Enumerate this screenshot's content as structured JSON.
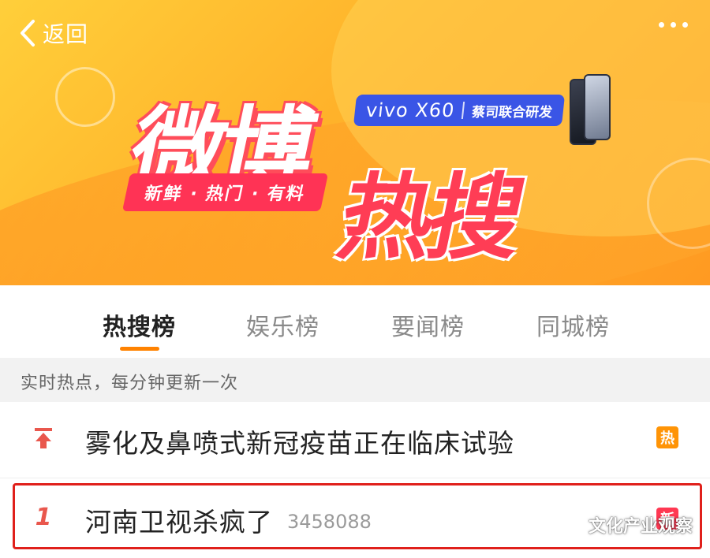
{
  "nav": {
    "back_label": "返回"
  },
  "banner": {
    "logo_text": "微博",
    "logo_hot_text": "热搜",
    "tagline": "新鲜 · 热门 · 有料",
    "sponsor_model": "vivo X60",
    "sponsor_note": "蔡司联合研发"
  },
  "tabs": [
    {
      "label": "热搜榜",
      "active": true
    },
    {
      "label": "娱乐榜",
      "active": false
    },
    {
      "label": "要闻榜",
      "active": false
    },
    {
      "label": "同城榜",
      "active": false
    }
  ],
  "subheader": "实时热点，每分钟更新一次",
  "list": [
    {
      "rank_icon": "top-arrow-icon",
      "title": "雾化及鼻喷式新冠疫苗正在临床试验",
      "count": "",
      "badge": "热"
    },
    {
      "rank": "1",
      "title": "河南卫视杀疯了",
      "count": "3458088",
      "badge": "新"
    }
  ],
  "watermark": "文化产业观察",
  "colors": {
    "accent": "#ff8200",
    "hot_badge": "#ff9406",
    "new_badge": "#ff3852",
    "highlight_border": "#e0201b",
    "rank_red": "#e9574d"
  }
}
